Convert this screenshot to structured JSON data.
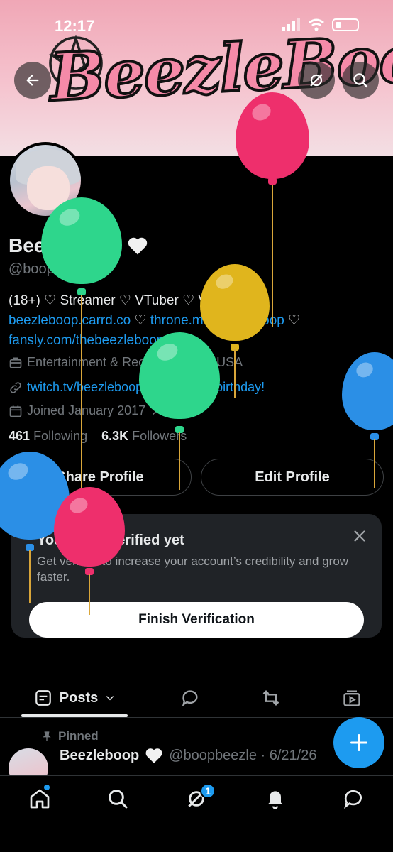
{
  "status_bar": {
    "time": "12:17"
  },
  "banner": {
    "logo_text": "BeezleBoop"
  },
  "profile": {
    "name": "Beezleboop",
    "name_emoji": "🤍",
    "handle": "@boopbeezle",
    "bio_line1": "(18+) ♡ Streamer ♡ VTuber ♡ VRChat ♡",
    "bio_link1": "beezleboop.carrd.co",
    "bio_link2": "throne.me/beezleboop",
    "bio_link3": "fansly.com/thebeezleboop",
    "separator": "♡",
    "category": "Entertainment & Recreation",
    "location": "USA",
    "website": "twitch.tv/beezleboop",
    "birthday": "Happy birthday!",
    "joined": "Joined January 2017",
    "following_count": "461",
    "following_label": "Following",
    "followers_count": "6.3K",
    "followers_label": "Followers"
  },
  "buttons": {
    "share_profile": "Share Profile",
    "edit_profile": "Edit Profile"
  },
  "verify_card": {
    "title": "You're not verified yet",
    "text": "Get verified to increase your account’s credibility and grow faster.",
    "button": "Finish Verification"
  },
  "tabs": {
    "posts": "Posts"
  },
  "pinned_post": {
    "pinned_label": "Pinned",
    "author": "Beezleboop",
    "author_emoji": "🤍",
    "handle_date": "@boopbeezle · 6/21/26"
  },
  "bottom_nav": {
    "messages_badge": "1"
  },
  "colors": {
    "accent": "#1d9bf0",
    "balloon_green": "#2ed68c",
    "balloon_yellow": "#e0b51d",
    "balloon_red": "#ee2f6c",
    "balloon_blue": "#2b8fe6"
  }
}
